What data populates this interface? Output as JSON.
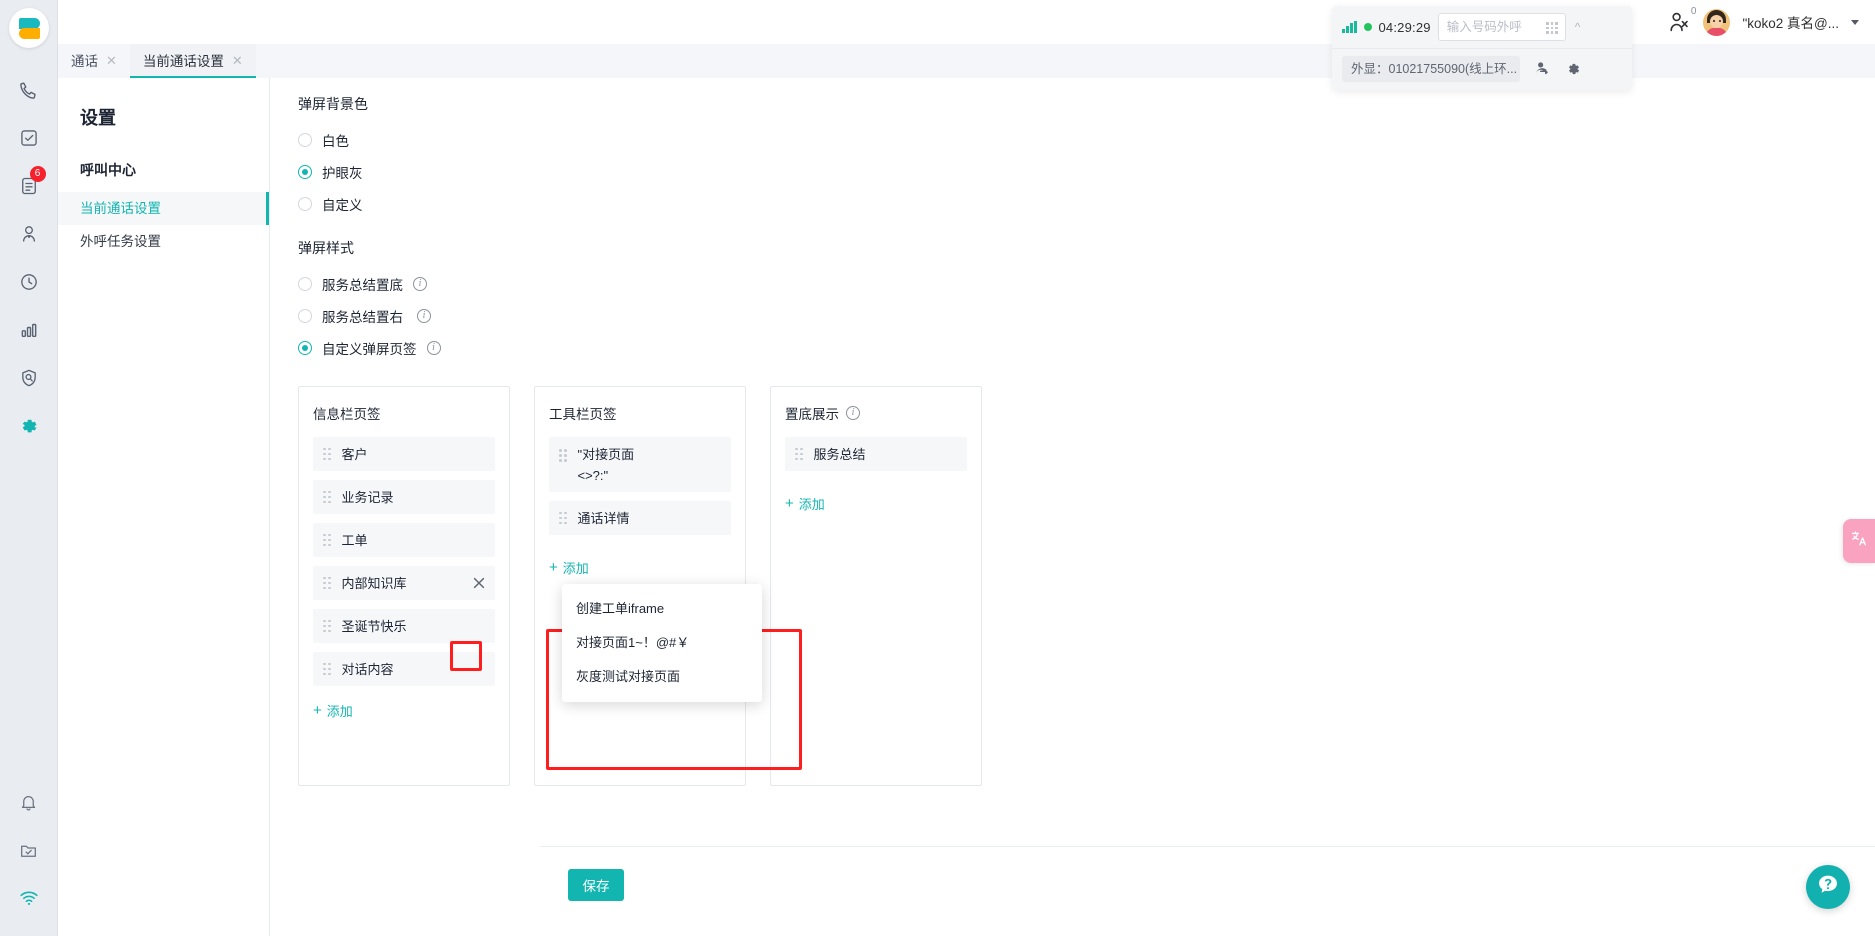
{
  "theme": {
    "accent": "#13b5b1",
    "badge_red": "#f5222d",
    "annotation_red": "#ff1e1e",
    "online_green": "#24c55f",
    "translate_pink": "#f9a3c0"
  },
  "rail": {
    "logo_name": "brand-logo",
    "items": [
      {
        "icon": "phone-icon",
        "badge": ""
      },
      {
        "icon": "task-check-icon",
        "badge": ""
      },
      {
        "icon": "document-icon",
        "badge": "6"
      },
      {
        "icon": "user-icon",
        "badge": ""
      },
      {
        "icon": "clock-icon",
        "badge": ""
      },
      {
        "icon": "bar-chart-icon",
        "badge": ""
      },
      {
        "icon": "shield-search-icon",
        "badge": ""
      },
      {
        "icon": "gear-icon",
        "badge": ""
      }
    ],
    "bottom_items": [
      {
        "icon": "bell-icon"
      },
      {
        "icon": "folder-check-icon"
      },
      {
        "icon": "wifi-icon"
      }
    ]
  },
  "callbar": {
    "signal_icon": "signal-bars-icon",
    "status_icon": "online-status-dot",
    "timer": "04:29:29",
    "dial_placeholder": "输入号码外呼",
    "dial_value": "",
    "keypad_icon": "keypad-icon",
    "collapse_icon": "chevron-up-icon",
    "caller_id": "外显：01021755090(线上环...",
    "transfer_icon": "agent-transfer-icon",
    "settings_icon": "gear-icon"
  },
  "topbar": {
    "agent_icon": "agent-status-icon",
    "agent_count": "0",
    "avatar": "user-avatar",
    "username": "\"koko2 真名@...",
    "caret_icon": "chevron-down-icon"
  },
  "tabs": [
    {
      "label": "通话",
      "active": false,
      "close_icon": "close-icon"
    },
    {
      "label": "当前通话设置",
      "active": true,
      "close_icon": "close-icon"
    }
  ],
  "subnav": {
    "title": "设置",
    "group_label": "呼叫中心",
    "items": [
      {
        "label": "当前通话设置",
        "active": true
      },
      {
        "label": "外呼任务设置",
        "active": false
      }
    ]
  },
  "background_section": {
    "title": "弹屏背景色",
    "options": [
      {
        "label": "白色",
        "checked": false
      },
      {
        "label": "护眼灰",
        "checked": true
      },
      {
        "label": "自定义",
        "checked": false
      }
    ]
  },
  "style_section": {
    "title": "弹屏样式",
    "options": [
      {
        "label": "服务总结置底",
        "checked": false,
        "info": true
      },
      {
        "label": "服务总结置右",
        "checked": false,
        "info": true
      },
      {
        "label": "自定义弹屏页签",
        "checked": true,
        "info": true
      }
    ]
  },
  "panels": [
    {
      "title": "信息栏页签",
      "info": false,
      "items": [
        {
          "label": "客户",
          "two_line": false,
          "has_close": false
        },
        {
          "label": "业务记录",
          "two_line": false,
          "has_close": false
        },
        {
          "label": "工单",
          "two_line": false,
          "has_close": false
        },
        {
          "label": "内部知识库",
          "two_line": false,
          "has_close": true
        },
        {
          "label": "圣诞节快乐",
          "two_line": false,
          "has_close": false
        },
        {
          "label": "对话内容",
          "two_line": false,
          "has_close": false
        }
      ],
      "add_label": "添加"
    },
    {
      "title": "工具栏页签",
      "info": false,
      "items": [
        {
          "label": "\"对接页面",
          "label2": "<>?:\"",
          "two_line": true,
          "has_close": false
        },
        {
          "label": "通话详情",
          "two_line": false,
          "has_close": false
        }
      ],
      "add_label": "添加"
    },
    {
      "title": "置底展示",
      "info": true,
      "items": [
        {
          "label": "服务总结",
          "two_line": false,
          "has_close": false
        }
      ],
      "add_label": "添加"
    }
  ],
  "dropdown": {
    "items": [
      {
        "label": "创建工单iframe"
      },
      {
        "label": "对接页面1~！@#￥"
      },
      {
        "label": "灰度测试对接页面"
      }
    ]
  },
  "footer": {
    "save_label": "保存"
  },
  "floating": {
    "translate_label": "中A",
    "translate_icon": "translate-icon",
    "help_icon": "help-question-icon"
  }
}
